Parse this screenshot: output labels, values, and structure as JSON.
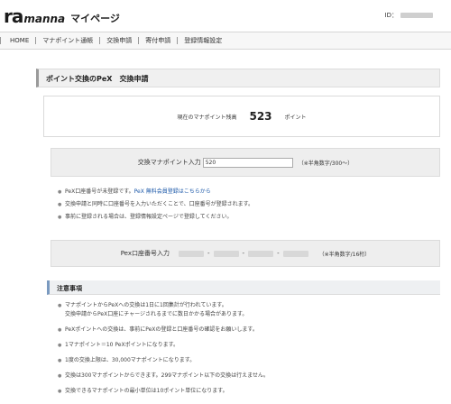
{
  "header": {
    "logo_mark": "ra",
    "logo_text": "manna",
    "title": "マイページ",
    "id_label": "ID："
  },
  "nav": {
    "items": [
      "HOME",
      "マナポイント通帳",
      "交換申請",
      "寄付申請",
      "登録情報設定"
    ]
  },
  "page": {
    "title": "ポイント交換のPeX　交換申請"
  },
  "balance": {
    "label": "現在のマナポイント残高",
    "value": "523",
    "unit": "ポイント"
  },
  "exchange": {
    "label": "交換マナポイント入力",
    "value": "520",
    "note": "（※半角数字/300〜）"
  },
  "info": {
    "line1_text": "PeX口座番号が未登録です。",
    "line1_link": "PeX 無料会員登録はこちらから",
    "line2": "交換申請と同時に口座番号を入力いただくことで、口座番号が登録されます。",
    "line3": "事前に登録される場合は、登録情報設定ページで登録してください。"
  },
  "account": {
    "label": "Pex口座番号入力",
    "note": "（※半角数字/16桁）"
  },
  "notes": {
    "title": "注意事項",
    "items": [
      "マナポイントからPeXへの交換は1日に1回集計が行われています。",
      "交換申請からPeX口座にチャージされるまでに数日かかる場合があります。",
      "PeXポイントへの交換は、事前にPeXの登録と口座番号の確認をお願いします。",
      "1マナポイント＝10 PeXポイントになります。",
      "1度の交換上限は、30,000マナポイントになります。",
      "交換は300マナポイントからできます。299マナポイント以下の交換は行えません。",
      "交換できるマナポイントの最小単位は10ポイント単位になります。"
    ]
  }
}
